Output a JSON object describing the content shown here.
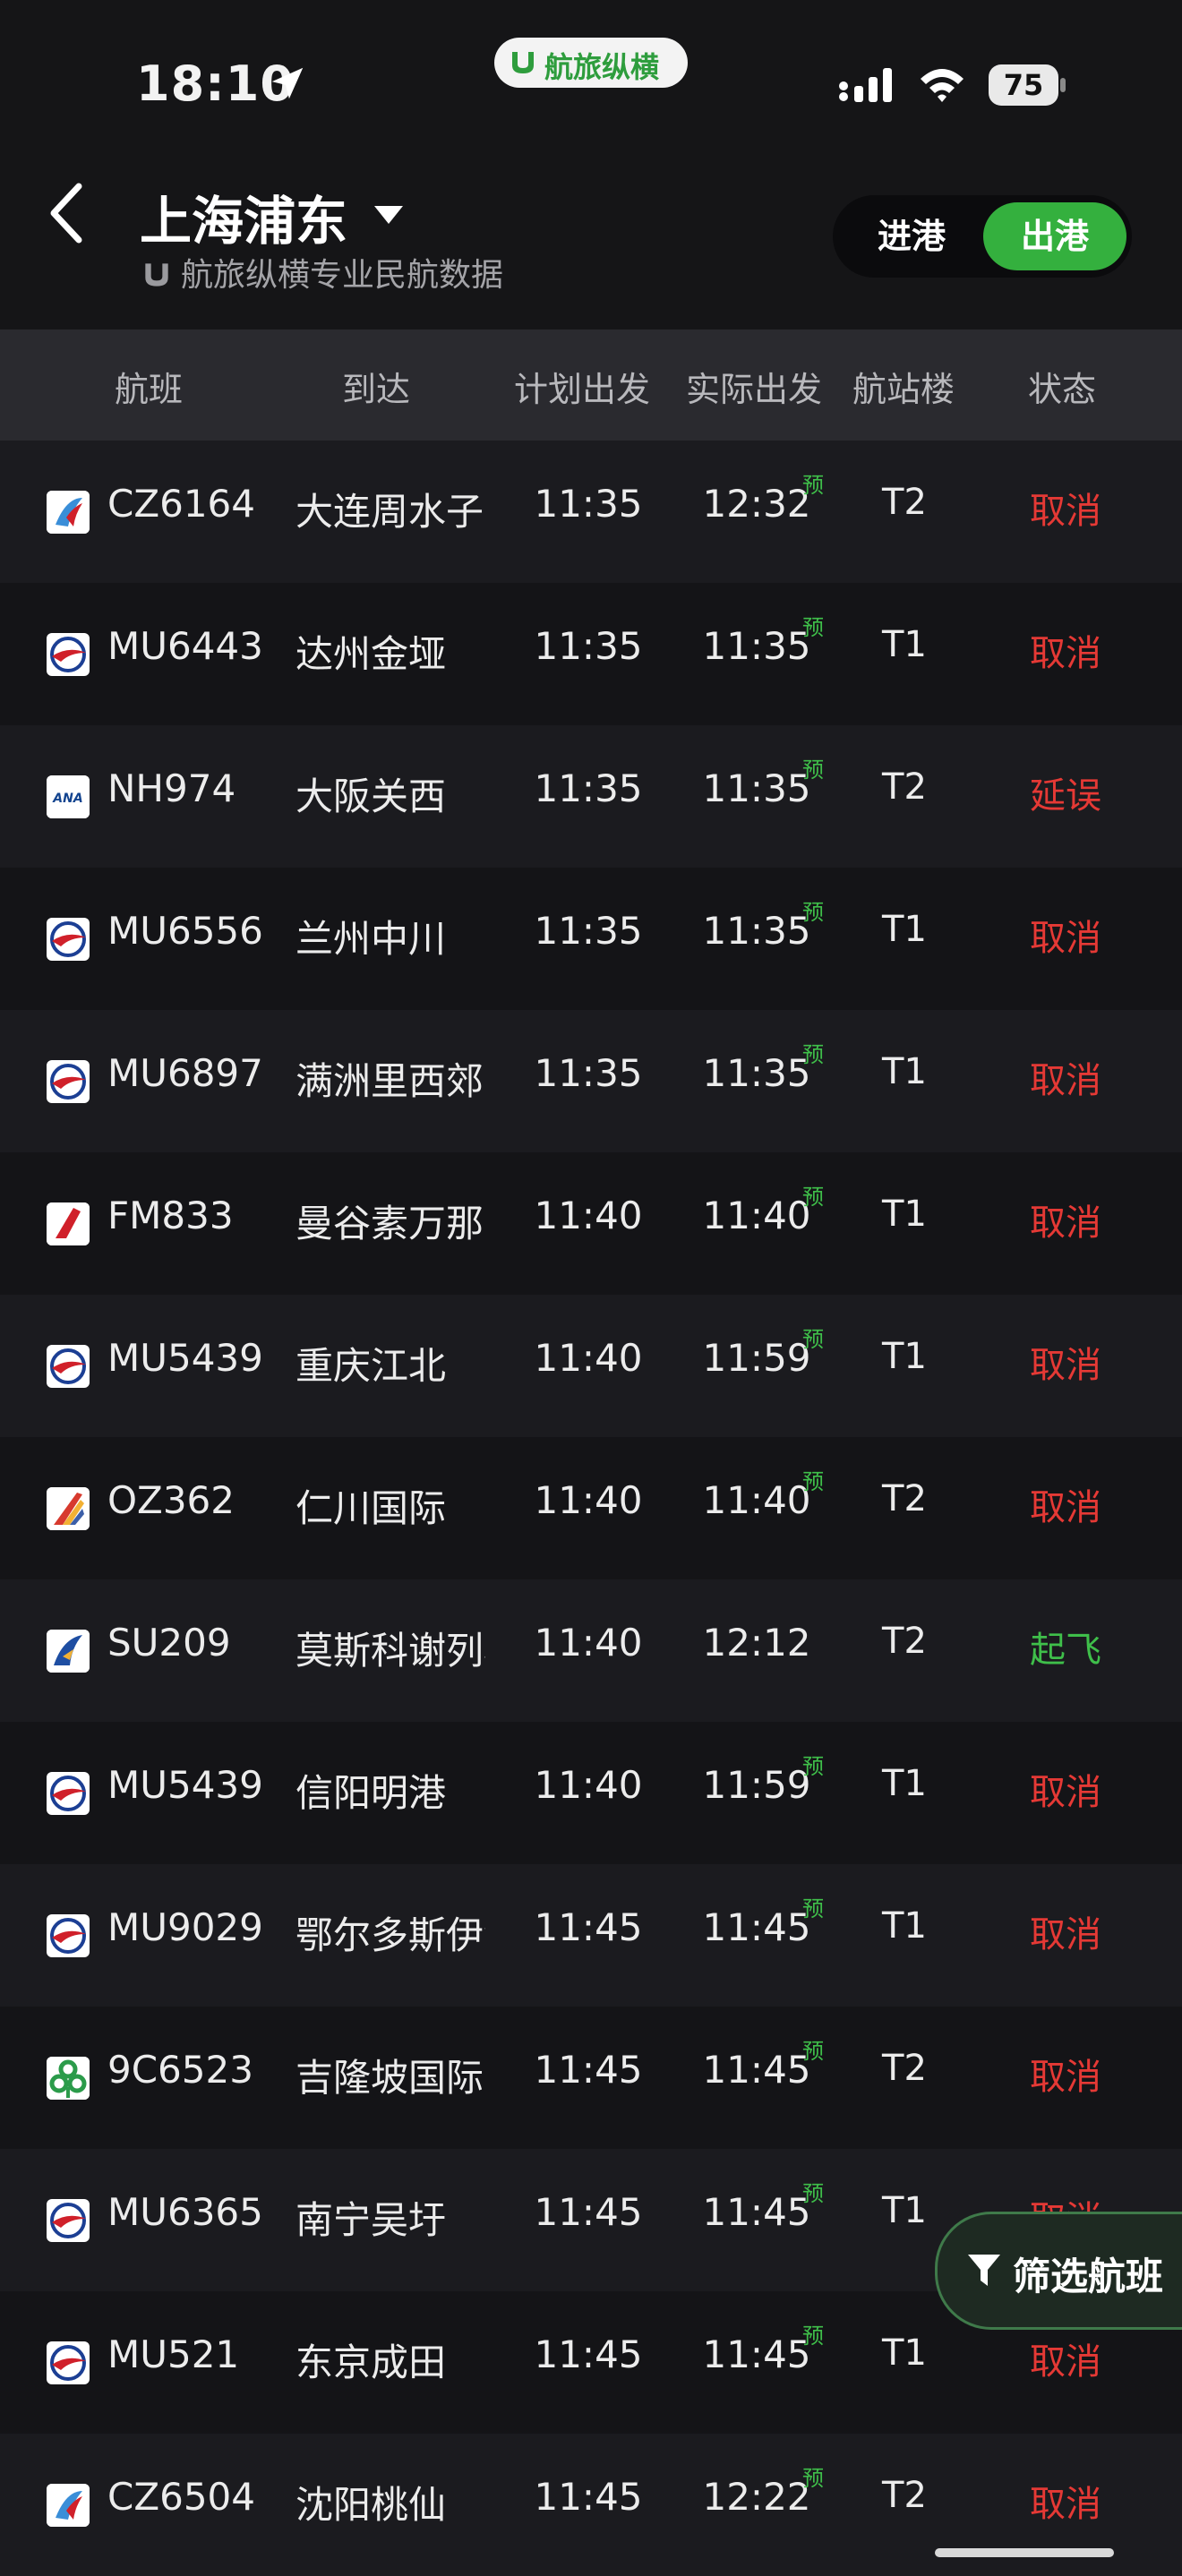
{
  "status_bar": {
    "time": "18:10",
    "battery": "75",
    "brand": "航旅纵横"
  },
  "header": {
    "airport": "上海浦东",
    "subtitle": "航旅纵横专业民航数据",
    "seg_in": "进港",
    "seg_out": "出港",
    "selected": "出港"
  },
  "columns": [
    "航班",
    "到达",
    "计划出发",
    "实际出发",
    "航站楼",
    "状态"
  ],
  "predicted_mark": "预",
  "colors": {
    "accent_green": "#34b03e",
    "status_cancel": "#e53935",
    "status_depart": "#3fbf4a"
  },
  "flights": [
    {
      "airline_icon": "china-southern-logo-icon",
      "flight": "CZ6164",
      "dest": "大连周水子",
      "sched": "11:35",
      "actual": "12:32",
      "predicted": true,
      "terminal": "T2",
      "status": "取消",
      "status_color": "red"
    },
    {
      "airline_icon": "china-eastern-logo-icon",
      "flight": "MU6443",
      "dest": "达州金垭",
      "sched": "11:35",
      "actual": "11:35",
      "predicted": true,
      "terminal": "T1",
      "status": "取消",
      "status_color": "red"
    },
    {
      "airline_icon": "ana-logo-icon",
      "flight": "NH974",
      "dest": "大阪关西",
      "sched": "11:35",
      "actual": "11:35",
      "predicted": true,
      "terminal": "T2",
      "status": "延误",
      "status_color": "red"
    },
    {
      "airline_icon": "china-eastern-logo-icon",
      "flight": "MU6556",
      "dest": "兰州中川",
      "sched": "11:35",
      "actual": "11:35",
      "predicted": true,
      "terminal": "T1",
      "status": "取消",
      "status_color": "red"
    },
    {
      "airline_icon": "china-eastern-logo-icon",
      "flight": "MU6897",
      "dest": "满洲里西郊",
      "sched": "11:35",
      "actual": "11:35",
      "predicted": true,
      "terminal": "T1",
      "status": "取消",
      "status_color": "red"
    },
    {
      "airline_icon": "shanghai-airlines-logo-icon",
      "flight": "FM833",
      "dest": "曼谷素万那普",
      "sched": "11:40",
      "actual": "11:40",
      "predicted": true,
      "terminal": "T1",
      "status": "取消",
      "status_color": "red"
    },
    {
      "airline_icon": "china-eastern-logo-icon",
      "flight": "MU5439",
      "dest": "重庆江北",
      "sched": "11:40",
      "actual": "11:59",
      "predicted": true,
      "terminal": "T1",
      "status": "取消",
      "status_color": "red"
    },
    {
      "airline_icon": "asiana-logo-icon",
      "flight": "OZ362",
      "dest": "仁川国际",
      "sched": "11:40",
      "actual": "11:40",
      "predicted": true,
      "terminal": "T2",
      "status": "取消",
      "status_color": "red"
    },
    {
      "airline_icon": "aeroflot-logo-icon",
      "flight": "SU209",
      "dest": "莫斯科谢列梅",
      "sched": "11:40",
      "actual": "12:12",
      "predicted": false,
      "terminal": "T2",
      "status": "起飞",
      "status_color": "green"
    },
    {
      "airline_icon": "china-eastern-logo-icon",
      "flight": "MU5439",
      "dest": "信阳明港",
      "sched": "11:40",
      "actual": "11:59",
      "predicted": true,
      "terminal": "T1",
      "status": "取消",
      "status_color": "red"
    },
    {
      "airline_icon": "china-eastern-logo-icon",
      "flight": "MU9029",
      "dest": "鄂尔多斯伊金",
      "sched": "11:45",
      "actual": "11:45",
      "predicted": true,
      "terminal": "T1",
      "status": "取消",
      "status_color": "red"
    },
    {
      "airline_icon": "spring-airlines-logo-icon",
      "flight": "9C6523",
      "dest": "吉隆坡国际",
      "sched": "11:45",
      "actual": "11:45",
      "predicted": true,
      "terminal": "T2",
      "status": "取消",
      "status_color": "red"
    },
    {
      "airline_icon": "china-eastern-logo-icon",
      "flight": "MU6365",
      "dest": "南宁吴圩",
      "sched": "11:45",
      "actual": "11:45",
      "predicted": true,
      "terminal": "T1",
      "status": "取消",
      "status_color": "red"
    },
    {
      "airline_icon": "china-eastern-logo-icon",
      "flight": "MU521",
      "dest": "东京成田",
      "sched": "11:45",
      "actual": "11:45",
      "predicted": true,
      "terminal": "T1",
      "status": "取消",
      "status_color": "red"
    },
    {
      "airline_icon": "china-southern-logo-icon",
      "flight": "CZ6504",
      "dest": "沈阳桃仙",
      "sched": "11:45",
      "actual": "12:22",
      "predicted": true,
      "terminal": "T2",
      "status": "取消",
      "status_color": "red"
    }
  ],
  "filter_button": "筛选航班"
}
